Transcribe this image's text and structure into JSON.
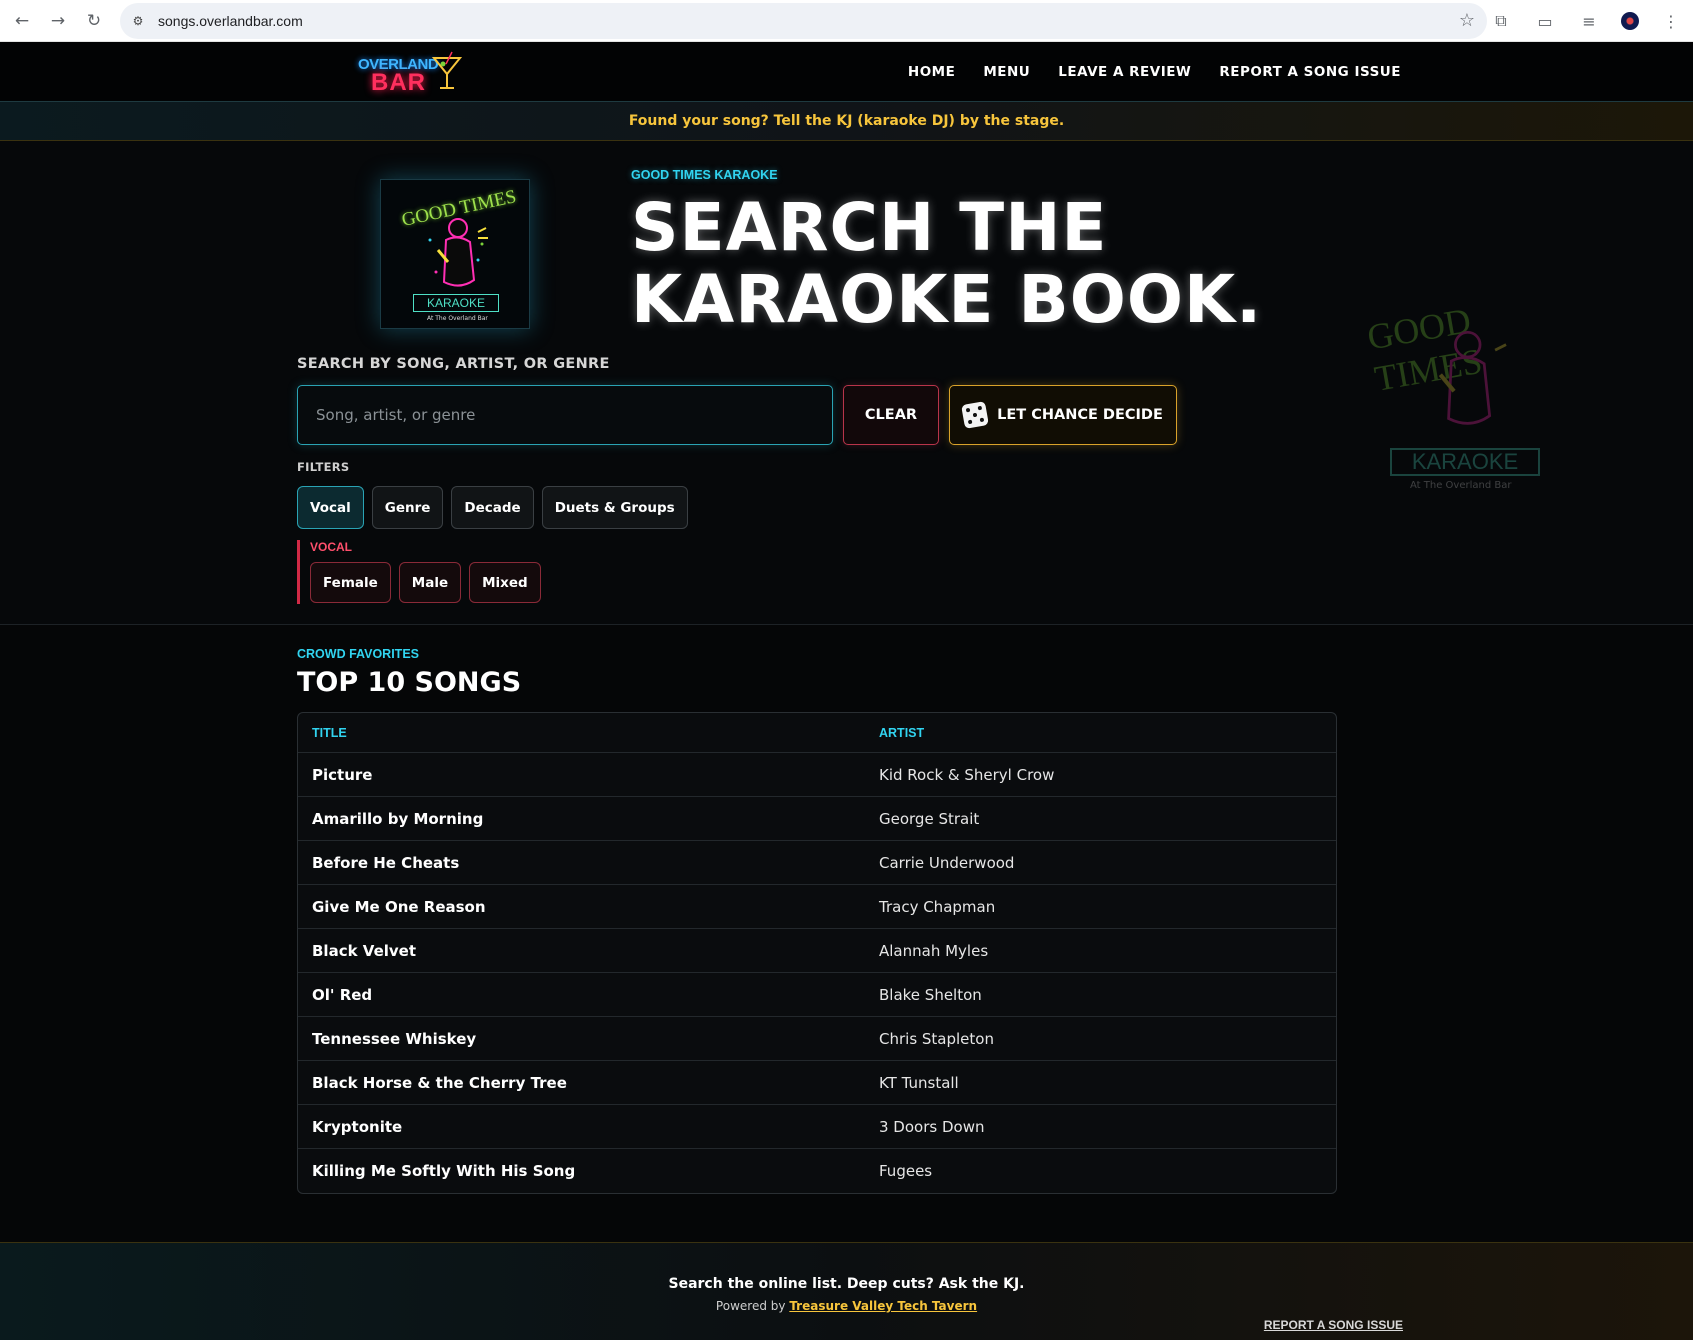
{
  "browser": {
    "url": "songs.overlandbar.com",
    "back_icon": "←",
    "forward_icon": "→",
    "reload_icon": "↻",
    "site_icon": "⚙",
    "star_icon": "☆",
    "ext_icon": "⧉",
    "cast_icon": "▭",
    "media_icon": "≡"
  },
  "header": {
    "logo_top": "OVERLAND",
    "logo_bottom": "BAR",
    "nav": [
      {
        "label": "HOME"
      },
      {
        "label": "MENU"
      },
      {
        "label": "LEAVE A REVIEW"
      },
      {
        "label": "REPORT A SONG ISSUE"
      }
    ]
  },
  "announcement": "Found your song? Tell the KJ (karaoke DJ) by the stage.",
  "hero": {
    "album_text_top": "GOOD TIMES",
    "album_text_banner": "KARAOKE",
    "album_text_sub": "At The Overland Bar",
    "eyebrow": "GOOD TIMES KARAOKE",
    "title": "SEARCH THE KARAOKE BOOK.",
    "watermark_top": "GOOD TIMES",
    "watermark_banner": "KARAOKE",
    "watermark_sub": "At The Overland Bar"
  },
  "search": {
    "label": "SEARCH BY SONG, ARTIST, OR GENRE",
    "placeholder": "Song, artist, or genre",
    "value": "",
    "clear_label": "CLEAR",
    "chance_label": "LET CHANCE DECIDE"
  },
  "filters": {
    "label": "FILTERS",
    "tabs": [
      {
        "label": "Vocal",
        "active": true
      },
      {
        "label": "Genre",
        "active": false
      },
      {
        "label": "Decade",
        "active": false
      },
      {
        "label": "Duets & Groups",
        "active": false
      }
    ],
    "vocal": {
      "label": "VOCAL",
      "options": [
        {
          "label": "Female"
        },
        {
          "label": "Male"
        },
        {
          "label": "Mixed"
        }
      ]
    }
  },
  "top10": {
    "eyebrow": "CROWD FAVORITES",
    "title": "TOP 10 SONGS",
    "columns": {
      "title": "TITLE",
      "artist": "ARTIST"
    },
    "rows": [
      {
        "title": "Picture",
        "artist": "Kid Rock & Sheryl Crow"
      },
      {
        "title": "Amarillo by Morning",
        "artist": "George Strait"
      },
      {
        "title": "Before He Cheats",
        "artist": "Carrie Underwood"
      },
      {
        "title": "Give Me One Reason",
        "artist": "Tracy Chapman"
      },
      {
        "title": "Black Velvet",
        "artist": "Alannah Myles"
      },
      {
        "title": "Ol' Red",
        "artist": "Blake Shelton"
      },
      {
        "title": "Tennessee Whiskey",
        "artist": "Chris Stapleton"
      },
      {
        "title": "Black Horse & the Cherry Tree",
        "artist": "KT Tunstall"
      },
      {
        "title": "Kryptonite",
        "artist": "3 Doors Down"
      },
      {
        "title": "Killing Me Softly With His Song",
        "artist": "Fugees"
      }
    ]
  },
  "footer": {
    "main": "Search the online list. Deep cuts? Ask the KJ.",
    "powered_prefix": "Powered by",
    "powered_link": "Treasure Valley Tech Tavern",
    "report_link": "REPORT A SONG ISSUE"
  },
  "colors": {
    "accent_cyan": "#31d4f0",
    "accent_gold": "#f7c53c",
    "accent_red": "#d12a46",
    "background": "#050607"
  }
}
